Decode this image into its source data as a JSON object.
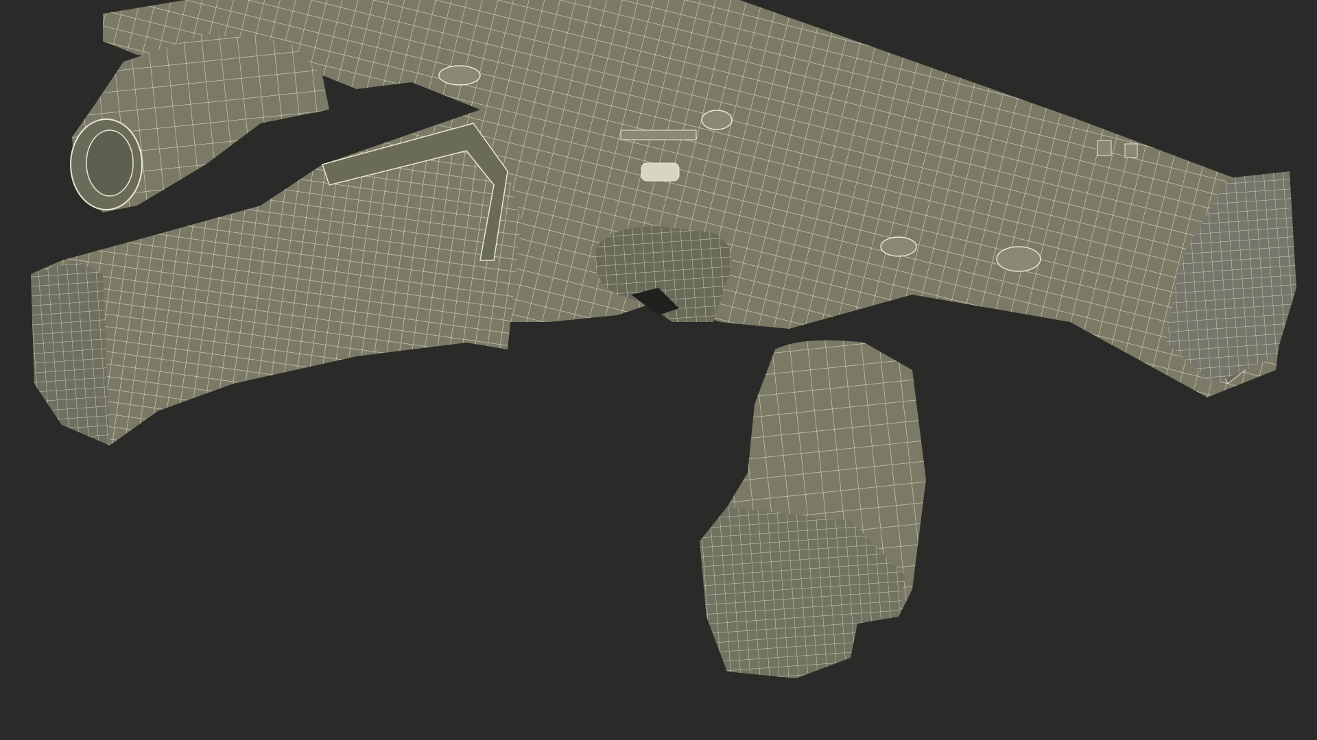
{
  "scene": {
    "background_color": "#2a2a28",
    "mesh_fill_color": "#7a7a66",
    "mesh_fill_dark": "#5f5f4f",
    "wire_color": "#e9e8d6",
    "subject": "wireframe-rifle-model"
  }
}
